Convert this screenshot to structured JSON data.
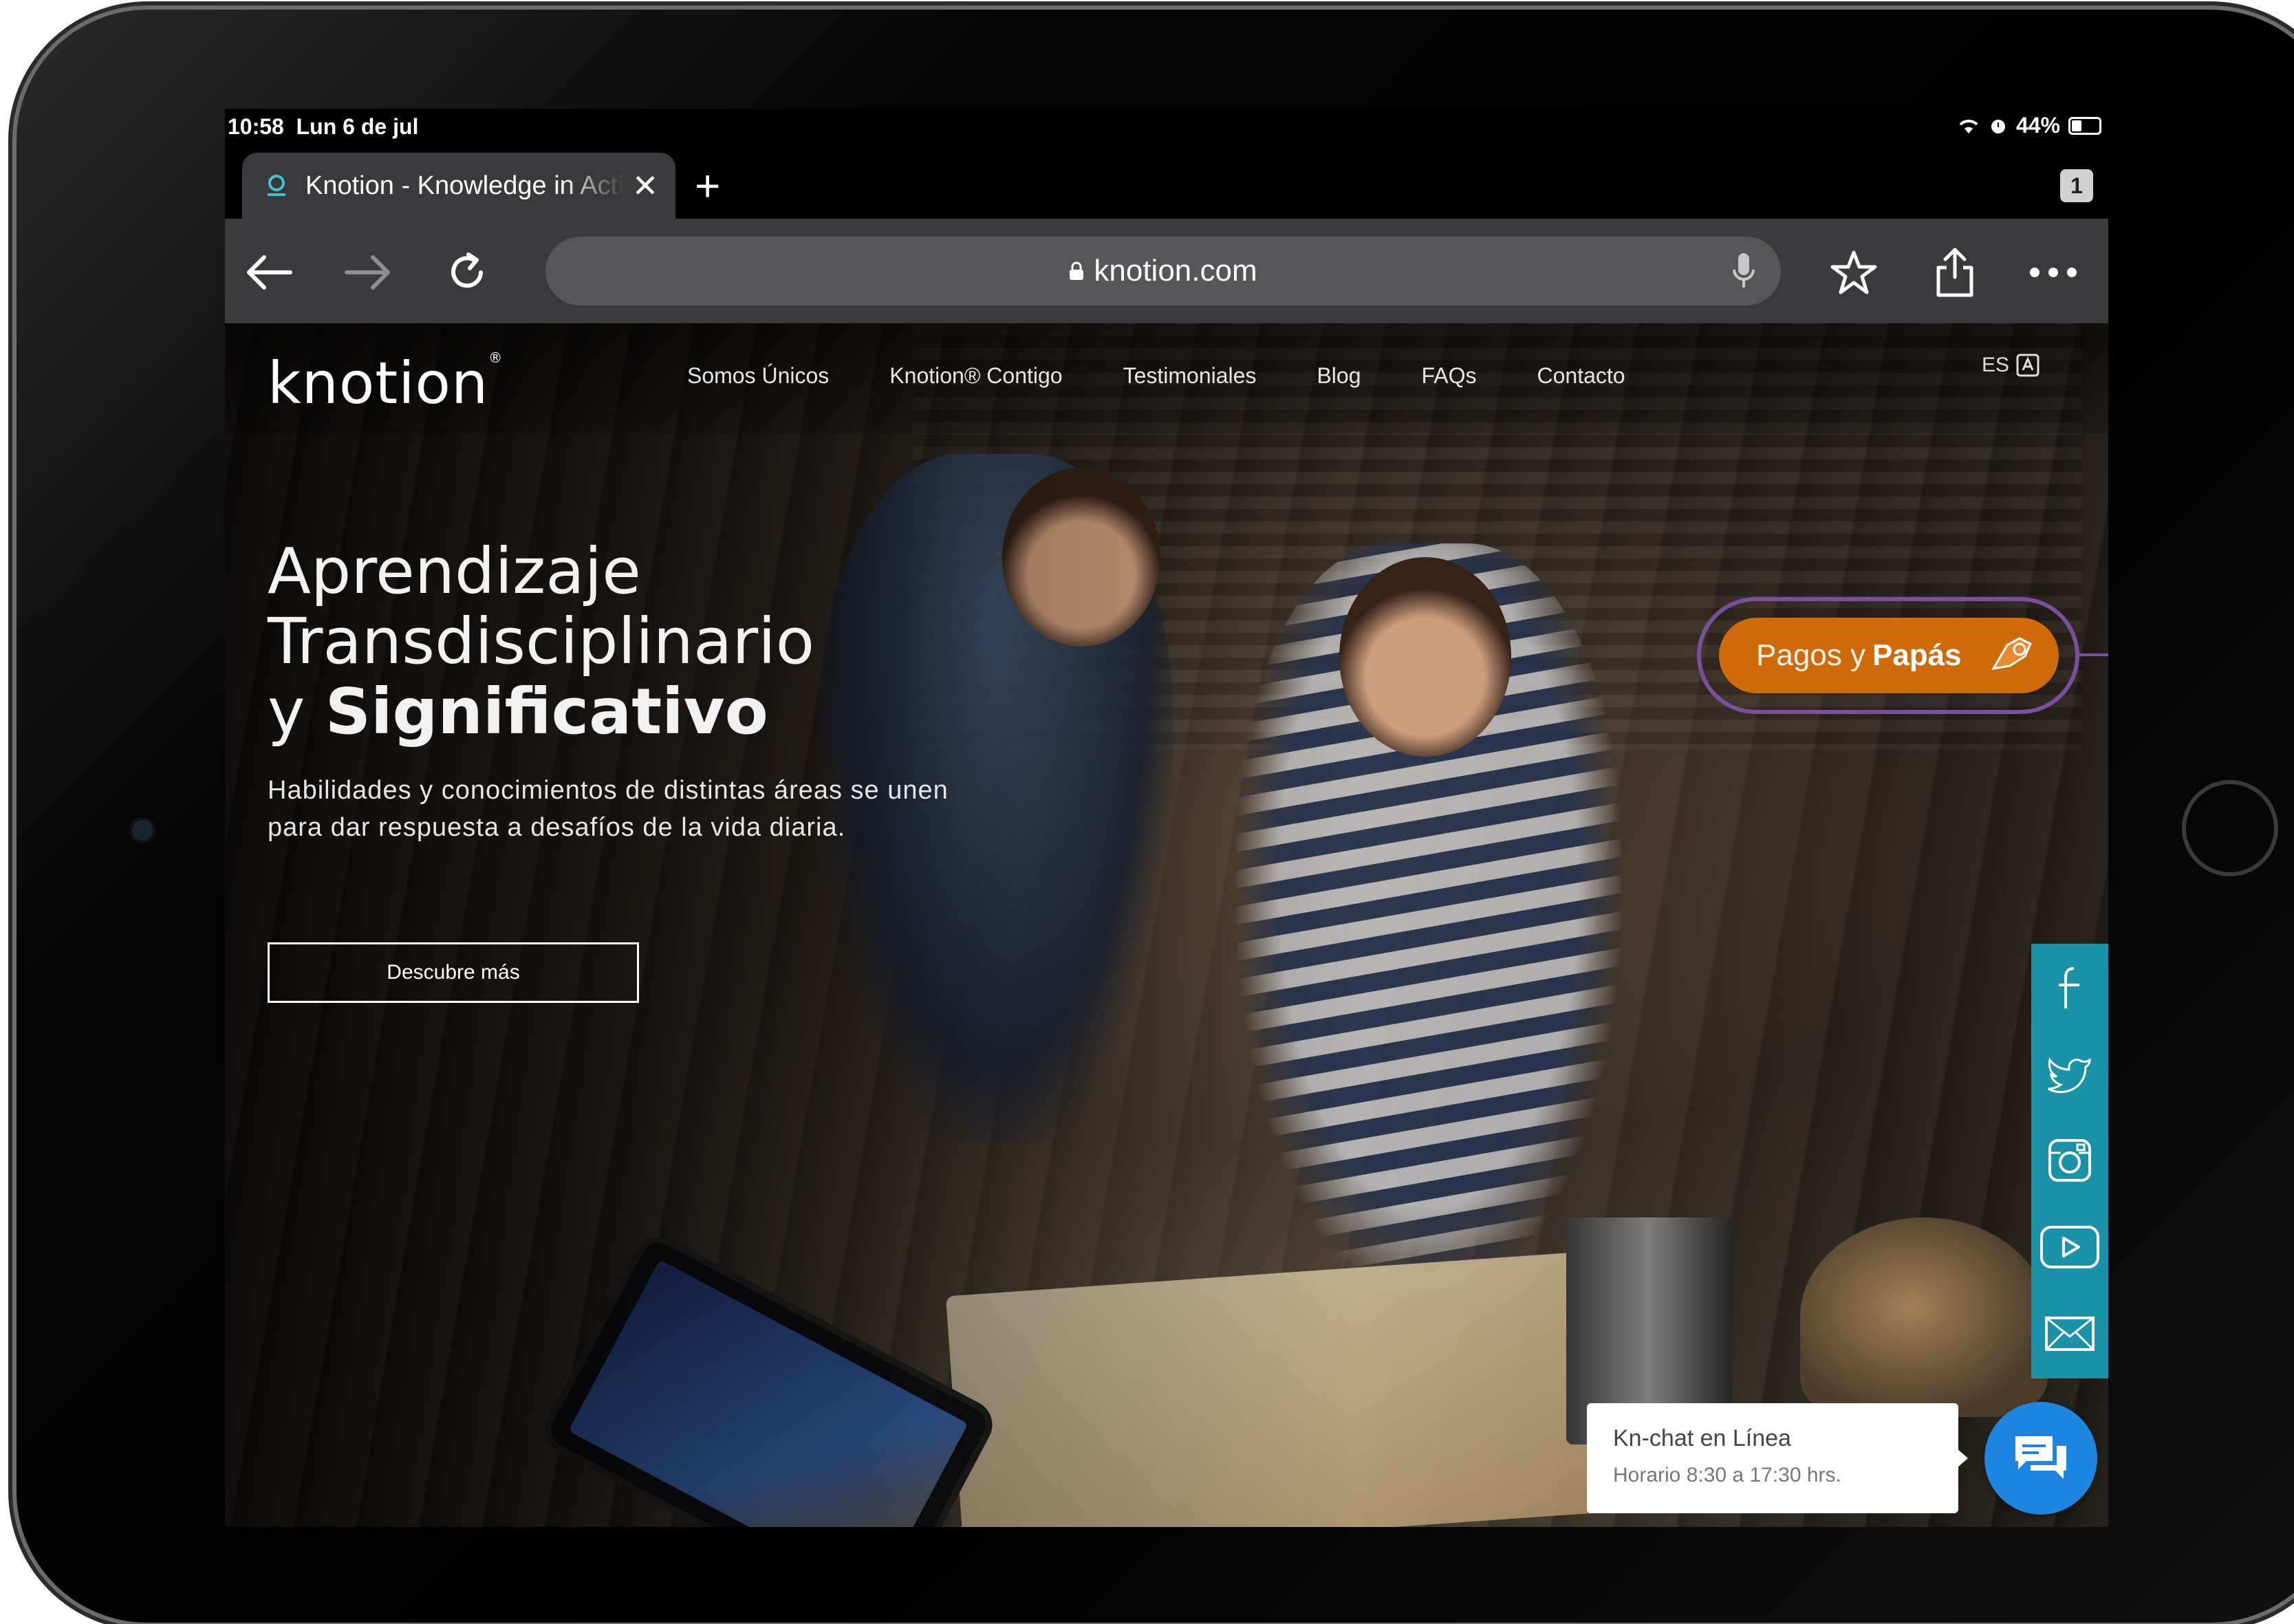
{
  "status": {
    "time": "10:58",
    "date": "Lun 6 de jul",
    "battery": "44%",
    "battery_level": 0.44
  },
  "browser": {
    "tab_title": "Knotion - Knowledge in Action",
    "tab_count": "1",
    "url": "knotion.com"
  },
  "site": {
    "logo": "knotion",
    "nav": [
      "Somos Únicos",
      "Knotion® Contigo",
      "Testimoniales",
      "Blog",
      "FAQs",
      "Contacto"
    ],
    "lang": "ES",
    "pagos_light": "Pagos y",
    "pagos_bold": "Papás",
    "hero_line1": "Aprendizaje",
    "hero_line2": "Transdisciplinario",
    "hero_line3_prefix": "y",
    "hero_line3_bold": "Significativo",
    "hero_sub": "Habilidades y conocimientos de distintas áreas se unen para dar respuesta a desafíos de la vida diaria.",
    "cta": "Descubre más",
    "chat_title": "Kn-chat en Línea",
    "chat_hours": "Horario 8:30 a 17:30 hrs."
  },
  "social": [
    "facebook-icon",
    "twitter-icon",
    "instagram-icon",
    "youtube-icon",
    "mail-icon"
  ],
  "colors": {
    "accent_orange": "#cf6a08",
    "callout_purple": "#7b4fa0",
    "social_teal": "#1a93a9",
    "chat_blue": "#1e86e0"
  }
}
